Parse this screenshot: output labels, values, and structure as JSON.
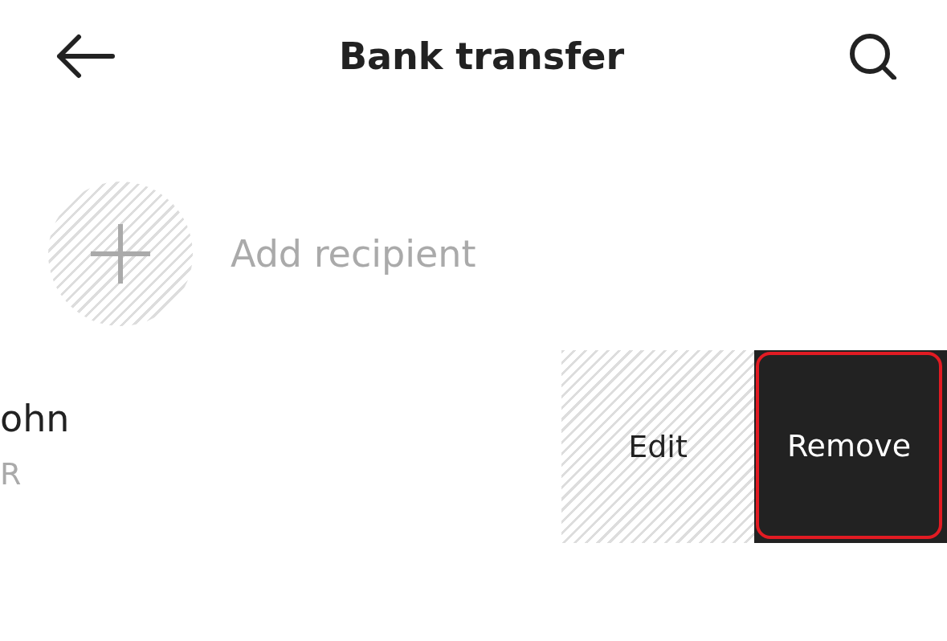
{
  "header": {
    "title": "Bank transfer"
  },
  "add_recipient": {
    "label": "Add recipient"
  },
  "recipients": [
    {
      "name": "ohn",
      "subtitle": "R",
      "actions": [
        {
          "label": "Edit",
          "kind": "edit",
          "highlighted": false
        },
        {
          "label": "Remove",
          "kind": "remove",
          "highlighted": true
        }
      ]
    }
  ]
}
